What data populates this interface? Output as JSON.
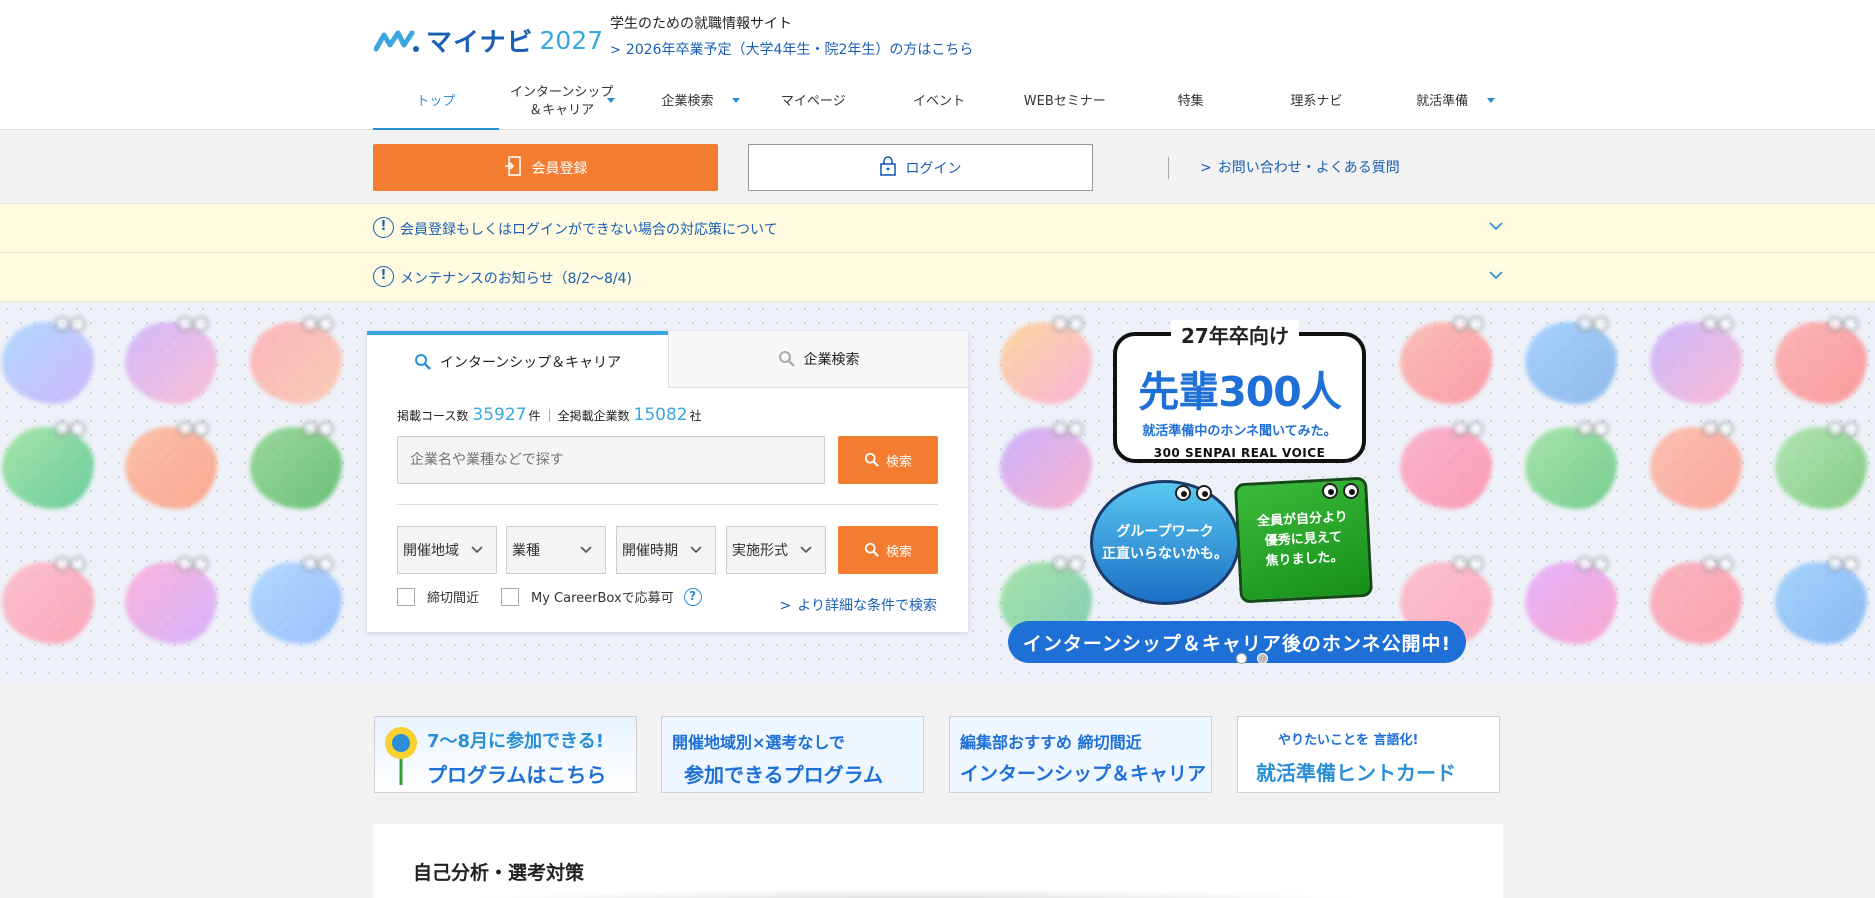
{
  "header": {
    "logo_text": "マイナビ",
    "logo_year": "2027",
    "tagline": "学生のための就職情報サイト",
    "prev_year_link": "2026年卒業予定（大学4年生・院2年生）の方はこちら"
  },
  "nav": [
    {
      "label": "トップ",
      "active": true
    },
    {
      "label": "インターンシップ\n＆キャリア",
      "dropdown": true
    },
    {
      "label": "企業検索",
      "dropdown": true
    },
    {
      "label": "マイページ"
    },
    {
      "label": "イベント"
    },
    {
      "label": "WEBセミナー"
    },
    {
      "label": "特集"
    },
    {
      "label": "理系ナビ"
    },
    {
      "label": "就活準備",
      "dropdown": true
    }
  ],
  "account": {
    "register_label": "会員登録",
    "login_label": "ログイン",
    "faq_link": "お問い合わせ・よくある質問"
  },
  "notices": [
    {
      "text": "会員登録もしくはログインができない場合の対応策について"
    },
    {
      "text": "メンテナンスのお知らせ（8/2〜8/4)"
    }
  ],
  "search": {
    "tab_internship": "インターンシップ＆キャリア",
    "tab_company": "企業検索",
    "course_count_label": "掲載コース数",
    "course_count": "35927",
    "course_unit": "件",
    "company_count_label": "全掲載企業数",
    "company_count": "15082",
    "company_unit": "社",
    "keyword_placeholder": "企業名や業種などで探す",
    "search_button": "検索",
    "filters": [
      "開催地域",
      "業種",
      "開催時期",
      "実施形式"
    ],
    "check_deadline": "締切間近",
    "check_careerbox": "My CareerBoxで応募可",
    "help_icon_text": "?",
    "detail_link": "より詳細な条件で検索"
  },
  "banner": {
    "top_label": "27年卒向け",
    "headline": "先輩300人",
    "subline": "就活準備中のホンネ聞いてみた。",
    "english": "300 SENPAI REAL VOICE",
    "bubble_blue_l1": "グループワーク",
    "bubble_blue_l2": "正直いらないかも。",
    "bubble_green_l1": "全員が自分より",
    "bubble_green_l2": "優秀に見えて",
    "bubble_green_l3": "焦りました。",
    "pill": "インターンシップ＆キャリア後のホンネ公開中!",
    "dots_count": 2,
    "active_dot": 1
  },
  "promo_banners": [
    {
      "line1": "7〜8月に参加できる!",
      "line2": "プログラムはこちら"
    },
    {
      "line1": "開催地域別×選考なしで",
      "line2": "参加できるプログラム"
    },
    {
      "line1": "編集部おすすめ 締切間近",
      "line2": "インターンシップ＆キャリア"
    },
    {
      "line1": "やりたいことを 言語化!",
      "line2": "就活準備ヒントカード"
    }
  ],
  "section": {
    "title": "自己分析・選考対策"
  },
  "colors": {
    "brand_blue": "#1a5fb4",
    "accent_blue": "#2a8fd6",
    "orange": "#f47c30",
    "notice_bg": "#fffbe0"
  }
}
